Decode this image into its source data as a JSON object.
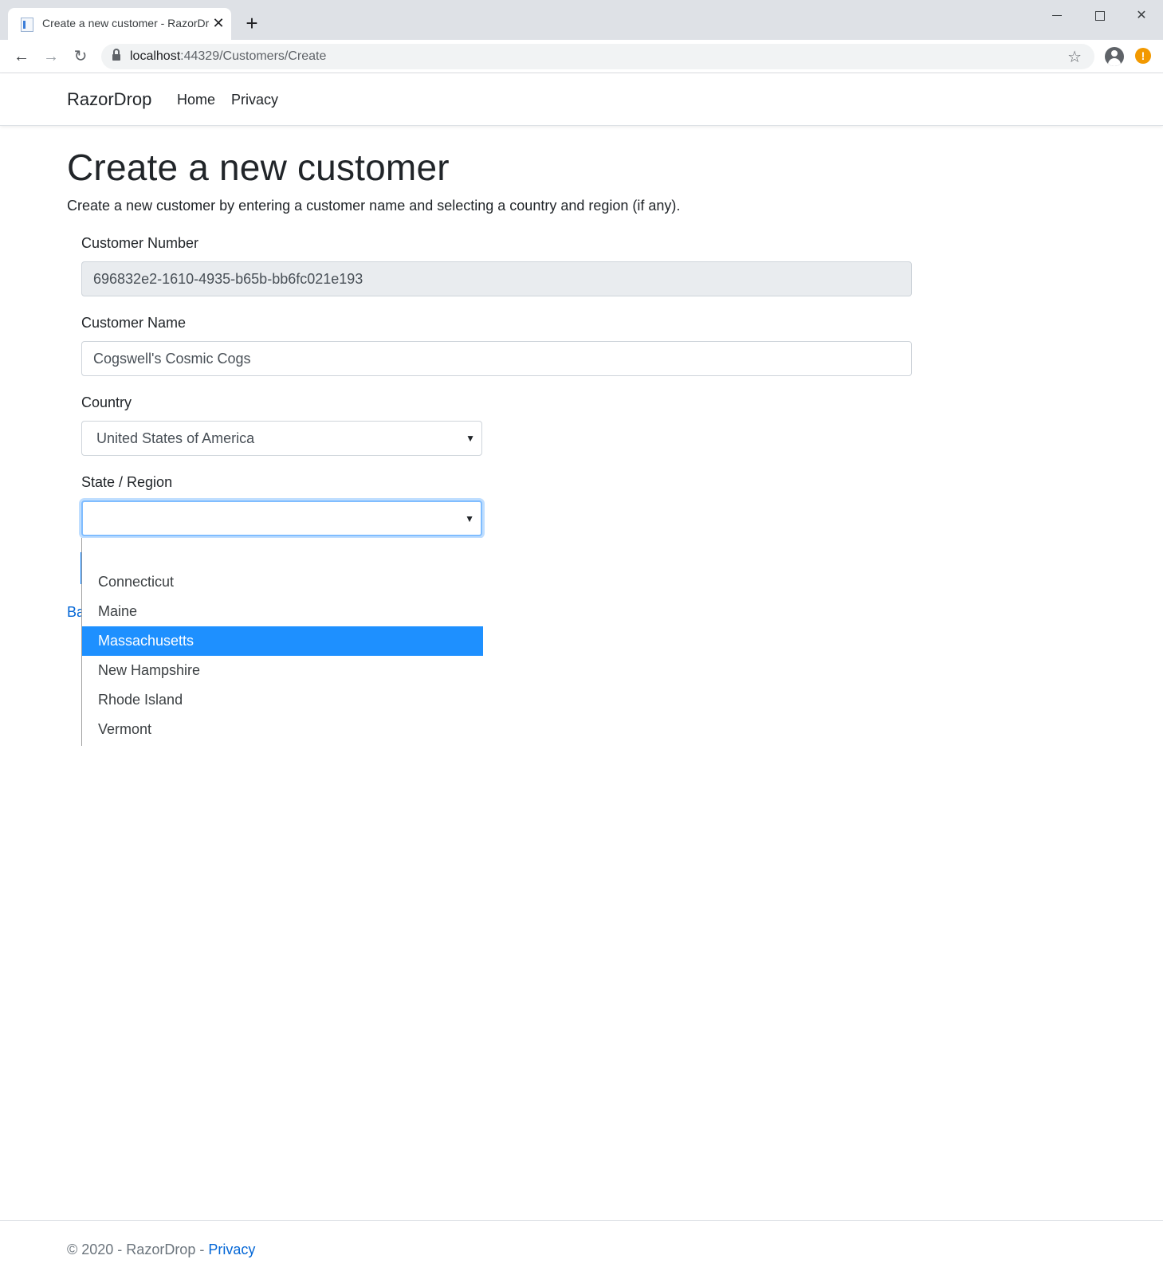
{
  "browser": {
    "tab_title": "Create a new customer - RazorDrop",
    "tab_close": "✕",
    "new_tab": "+",
    "url_host": "localhost",
    "url_rest": ":44329/Customers/Create",
    "window_close": "✕"
  },
  "navbar": {
    "brand": "RazorDrop",
    "links": [
      "Home",
      "Privacy"
    ]
  },
  "page": {
    "title": "Create a new customer",
    "lead": "Create a new customer by entering a customer name and selecting a country and region (if any)."
  },
  "form": {
    "customer_number": {
      "label": "Customer Number",
      "value": "696832e2-1610-4935-b65b-bb6fc021e193"
    },
    "customer_name": {
      "label": "Customer Name",
      "value": "Cogswell's Cosmic Cogs"
    },
    "country": {
      "label": "Country",
      "value": "United States of America"
    },
    "region": {
      "label": "State / Region",
      "value": "",
      "options": [
        "",
        "Connecticut",
        "Maine",
        "Massachusetts",
        "New Hampshire",
        "Rhode Island",
        "Vermont"
      ],
      "highlighted": "Massachusetts"
    }
  },
  "back_link": "Ba",
  "footer": {
    "text": "© 2020 - RazorDrop - ",
    "link": "Privacy"
  },
  "colors": {
    "highlight": "#1e90ff",
    "link": "#0366d6",
    "focus_border": "#80bdff"
  }
}
